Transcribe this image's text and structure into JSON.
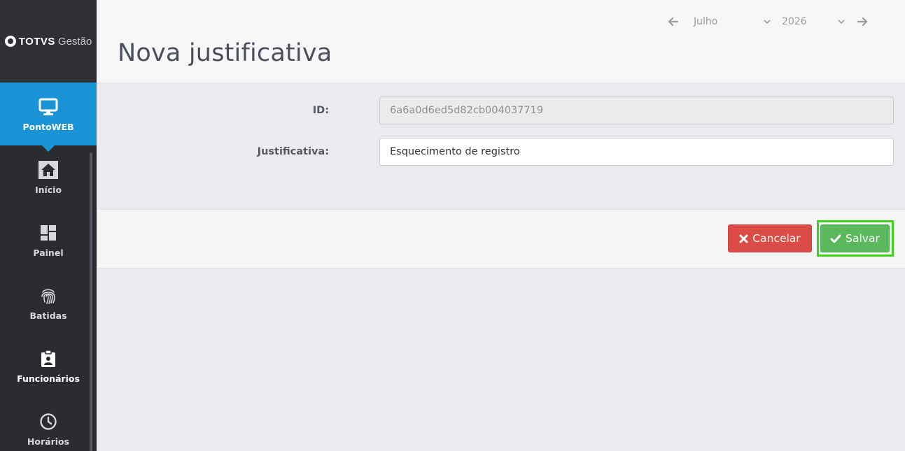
{
  "brand": {
    "logo_bold": "TOTVS",
    "logo_light": "Gestão"
  },
  "sidebar": {
    "items": [
      {
        "label": "PontoWEB",
        "icon": "monitor-icon",
        "active": true
      },
      {
        "label": "Início",
        "icon": "home-icon"
      },
      {
        "label": "Painel",
        "icon": "dashboard-icon"
      },
      {
        "label": "Batidas",
        "icon": "fingerprint-icon"
      },
      {
        "label": "Funcionários",
        "icon": "badge-icon"
      },
      {
        "label": "Horários",
        "icon": "clock-icon"
      }
    ]
  },
  "header": {
    "title": "Nova justificativa",
    "month": "Julho",
    "year": "2026"
  },
  "form": {
    "id_label": "ID:",
    "id_value": "6a6a0d6ed5d82cb004037719",
    "justificativa_label": "Justificativa:",
    "justificativa_value": "Esquecimento de registro"
  },
  "actions": {
    "cancel_label": "Cancelar",
    "save_label": "Salvar"
  },
  "colors": {
    "sidebar_bg": "#2b2c32",
    "active_blue": "#1a94d6",
    "cancel_red": "#dc4c47",
    "save_green": "#5cb85c",
    "highlight_green": "#3fd11b"
  }
}
